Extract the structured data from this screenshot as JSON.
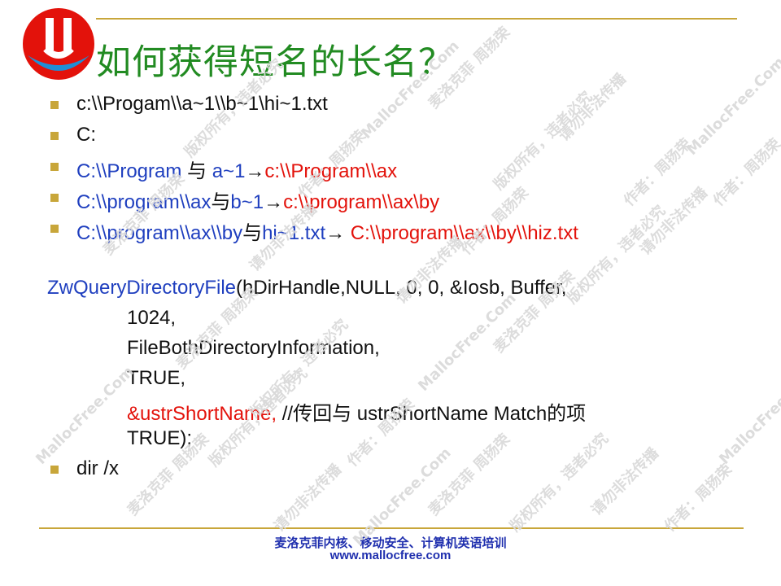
{
  "slide": {
    "title": "如何获得短名的长名？",
    "bullets_top": [
      {
        "segments": [
          {
            "text": "c:\\\\Progam\\\\a~1\\\\b~1\\hi~1.txt",
            "color": "black"
          }
        ]
      },
      {
        "segments": [
          {
            "text": "C:",
            "color": "black"
          }
        ]
      },
      {
        "segments": [
          {
            "text": "C:\\\\Program ",
            "color": "blue"
          },
          {
            "text": "与 ",
            "color": "black"
          },
          {
            "text": "a~1",
            "color": "blue"
          },
          {
            "text": "→",
            "color": "black"
          },
          {
            "text": "c:\\\\Program\\\\ax",
            "color": "red"
          }
        ]
      },
      {
        "segments": [
          {
            "text": "C:\\\\program\\\\ax",
            "color": "blue"
          },
          {
            "text": "与",
            "color": "black"
          },
          {
            "text": "b~1",
            "color": "blue"
          },
          {
            "text": "→",
            "color": "black"
          },
          {
            "text": "c:\\\\program\\\\ax\\by",
            "color": "red"
          }
        ]
      },
      {
        "segments": [
          {
            "text": "C:\\\\program\\\\ax\\\\by",
            "color": "blue"
          },
          {
            "text": "与",
            "color": "black"
          },
          {
            "text": "hi~1.txt",
            "color": "blue"
          },
          {
            "text": "→ ",
            "color": "black"
          },
          {
            "text": "C:\\\\program\\\\ax\\\\by\\\\hiz.txt",
            "color": "red"
          }
        ]
      }
    ],
    "code": {
      "func_name": "ZwQueryDirectoryFile",
      "first_line_args": "(hDirHandle,NULL, 0, 0, &Iosb, Buffer,",
      "arg_1024": "1024,",
      "arg_info_class": "FileBothDirectoryInformation,",
      "arg_true1": "TRUE,",
      "arg_shortname": "&ustrShortName,",
      "comment": " //传回与 ustrShortName Match的项",
      "arg_true2": "TRUE);"
    },
    "last_bullet": "dir /x"
  },
  "footer": {
    "line1": "麦洛克菲内核、移动安全、计算机英语培训",
    "line2": "www.mallocfree.com"
  },
  "watermarks": [
    "MallocFree.Com",
    "麦洛克菲 周扬荣",
    "版权所有，违者必究",
    "请勿非法传播",
    "作者：周扬荣"
  ],
  "colors": {
    "title": "#228b22",
    "bullet": "#c8a63a",
    "blue": "#1f3fbf",
    "red": "#e3120b",
    "footer": "#1f2fae"
  }
}
